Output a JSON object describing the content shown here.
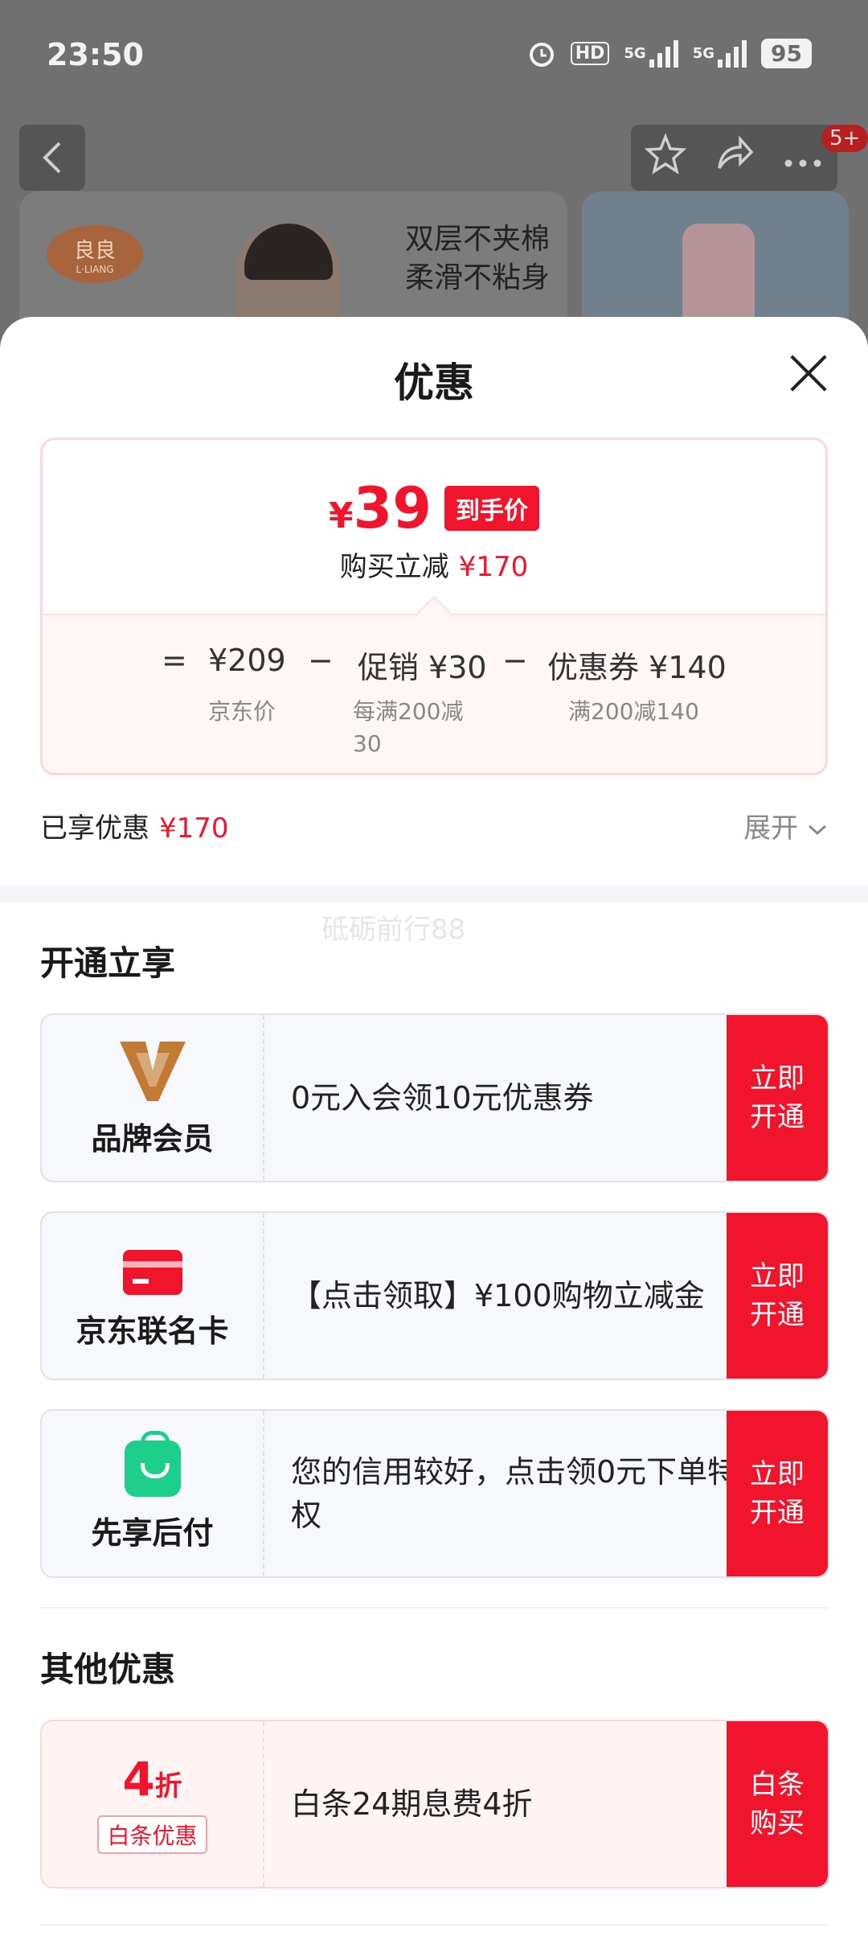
{
  "status_bar": {
    "time": "23:50",
    "hd": "HD",
    "net1": "5G",
    "net2": "5G",
    "battery": "95",
    "icons": [
      "alarm-icon",
      "hd-icon",
      "signal-icon",
      "signal-icon",
      "battery-icon"
    ]
  },
  "top_nav": {
    "back_icon": "chevron-left-icon",
    "actions": [
      "star-icon",
      "share-icon",
      "more-icon"
    ],
    "badge": "5+"
  },
  "background_banner": {
    "brand_name": "良良",
    "brand_sub": "L·LIANG",
    "slogan_line1": "双层不夹棉",
    "slogan_line2": "柔滑不粘身"
  },
  "sheet": {
    "title": "优惠",
    "close_icon": "close-icon"
  },
  "price_card": {
    "yen": "¥",
    "final_price": "39",
    "tag": "到手价",
    "sub_label": "购买立减",
    "sub_amount": "¥170",
    "calc": {
      "equals": "=",
      "base_price": "¥209",
      "base_label": "京东价",
      "minus1": "−",
      "promo": "促销 ¥30",
      "promo_label_line1": "每满200减",
      "promo_label_line2": "30",
      "minus2": "−",
      "coupon": "优惠券 ¥140",
      "coupon_label": "满200减140"
    }
  },
  "enjoyed": {
    "label": "已享优惠",
    "amount": "¥170",
    "expand_label": "展开",
    "expand_icon": "chevron-down-icon"
  },
  "watermark": "砥砺前行88",
  "section_open": {
    "title": "开通立享",
    "offers": [
      {
        "icon": "brand-v-icon",
        "label": "品牌会员",
        "desc": "0元入会领10元优惠券",
        "button": "立即开通"
      },
      {
        "icon": "card-icon",
        "label": "京东联名卡",
        "desc": "【点击领取】¥100购物立减金",
        "button": "立即开通"
      },
      {
        "icon": "shopping-bag-icon",
        "label": "先享后付",
        "desc": "您的信用较好，点击领0元下单特权",
        "button": "立即开通"
      }
    ]
  },
  "section_other": {
    "title": "其他优惠",
    "offers": [
      {
        "discount_value": "4",
        "discount_unit": "折",
        "tag": "白条优惠",
        "desc": "白条24期息费4折",
        "button": "白条购买"
      }
    ]
  },
  "colors": {
    "accent_red": "#f0142d",
    "member_gold": "#c27a34",
    "pay_green": "#1ccf8b"
  }
}
